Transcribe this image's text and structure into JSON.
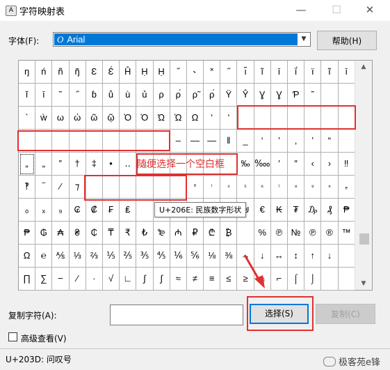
{
  "window": {
    "title": "字符映射表",
    "app_icon_glyph": "A"
  },
  "font": {
    "label": "字体(F):",
    "selected": "Arial",
    "type_glyph": "O"
  },
  "buttons": {
    "help": "帮助(H)",
    "select": "选择(S)",
    "copy": "复制(C)"
  },
  "grid": {
    "rows": [
      [
        "ŋ",
        "ń",
        "ñ",
        "ŋ̃",
        "Ɛ",
        "Ɛ́",
        "Ĥ",
        "Ḥ",
        "Ḥ",
        "˝",
        "˞",
        "˟",
        "˝",
        "ı̃",
        "ĩ",
        "ī",
        "ḯ",
        "ï",
        "ĩ",
        "ī"
      ],
      [
        "ĭ",
        "ī",
        "˜",
        "˝",
        "ɓ",
        "ů",
        "ù",
        "ủ",
        "ρ",
        "ρ́",
        "ρ̃",
        "ρ́",
        "Ÿ",
        "Ŷ",
        "Ɣ",
        "Ɣ",
        "Ƥ",
        "˜",
        "",
        ""
      ],
      [
        "`",
        "ẁ",
        "ω",
        "ώ",
        "ῶ",
        "ῷ",
        "Ὀ",
        "Ὁ",
        "Ώ",
        "Ὡ",
        "Ω",
        "ʹ",
        "ʹ",
        "",
        "",
        "",
        "",
        "",
        "",
        ""
      ],
      [
        "",
        "",
        "",
        "",
        "",
        "",
        "",
        "",
        "",
        "–",
        "—",
        "—",
        "‖",
        "_",
        "‘",
        "’",
        "‚",
        "‛",
        "“",
        ""
      ],
      [
        "„",
        "„",
        "‟",
        "†",
        "‡",
        "•",
        "‥",
        "…",
        "",
        "",
        "",
        "",
        "",
        "‰",
        "‱",
        "′",
        "″",
        "‹",
        "›",
        "‼"
      ],
      [
        "‽",
        "‾",
        "⁄",
        "⁊",
        "",
        "",
        "",
        "",
        "",
        "",
        "⁰",
        "ⁱ",
        "⁴",
        "⁵",
        "⁶",
        "⁷",
        "⁸",
        "⁹",
        "ⁿ",
        "ₑ"
      ],
      [
        "ₒ",
        "ₓ",
        "₉",
        "₢",
        "₡",
        "₣",
        "₤",
        "",
        "",
        "",
        "",
        "",
        "",
        "₪",
        "€",
        "₭",
        "₮",
        "₯",
        "₰",
        "₱"
      ],
      [
        "₱",
        "₲",
        "₳",
        "₴",
        "₵",
        "₸",
        "₹",
        "₺",
        "₻",
        "₼",
        "₽",
        "₾",
        "₿",
        "",
        "%",
        "℗",
        "№",
        "℗",
        "®",
        "™"
      ],
      [
        "Ω",
        "℮",
        "⅍",
        "⅓",
        "⅔",
        "⅕",
        "⅖",
        "⅗",
        "⅘",
        "⅙",
        "⅚",
        "⅛",
        "⅜",
        "→",
        "↓",
        "↔",
        "↕",
        "↑",
        "↓",
        ""
      ],
      [
        "∏",
        "∑",
        "−",
        "∕",
        "∙",
        "√",
        "∟",
        "∫",
        "∫",
        "≈",
        "≠",
        "≡",
        "≤",
        "≥",
        "⌂",
        "⌐",
        "⌠",
        "⌡",
        "",
        ""
      ]
    ]
  },
  "annotation": {
    "text": "随便选择一个空白框"
  },
  "tooltip": {
    "text": "U+206E: 民族数字形状"
  },
  "copy": {
    "label": "复制字符(A):",
    "value": ""
  },
  "advanced": {
    "label": "高级查看(V)",
    "checked": false
  },
  "status": {
    "text": "U+203D: 问叹号"
  },
  "watermark": {
    "text": "极客苑e锋"
  },
  "colors": {
    "accent": "#0078d7",
    "annotation_red": "#e03030"
  },
  "icons": {
    "minimize": "—",
    "maximize": "☐",
    "close": "✕",
    "dropdown": "▼",
    "scroll_up": "▲",
    "scroll_down": "▼"
  }
}
